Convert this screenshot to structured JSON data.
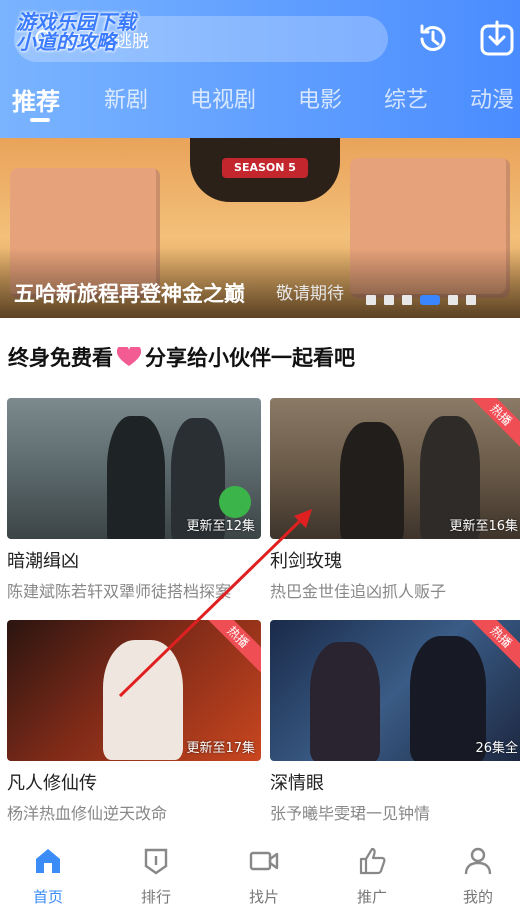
{
  "header": {
    "search_text": "密室大逃脱",
    "watermark": "游戏乐园下载\n小道的攻略"
  },
  "tabs": [
    "推荐",
    "新剧",
    "电视剧",
    "电影",
    "综艺",
    "动漫"
  ],
  "banner": {
    "title": "五哈新旅程再登神金之巅",
    "subtitle": "敬请期待",
    "logo_text": "SEASON 5",
    "dots": 6,
    "active_dot": 3
  },
  "section": {
    "title": "终身免费看",
    "title2": "分享给小伙伴一起看吧"
  },
  "cards": [
    {
      "title": "暗潮缉凶",
      "desc": "陈建斌陈若轩双犟师徒搭档探案",
      "episode": "更新至12集",
      "hot": ""
    },
    {
      "title": "利剑玫瑰",
      "desc": "热巴金世佳追凶抓人贩子",
      "episode": "更新至16集",
      "hot": "热播"
    },
    {
      "title": "凡人修仙传",
      "desc": "杨洋热血修仙逆天改命",
      "episode": "更新至17集",
      "hot": "热播"
    },
    {
      "title": "深情眼",
      "desc": "张予曦毕雯珺一见钟情",
      "episode": "26集全",
      "hot": "热播"
    }
  ],
  "nav": [
    "首页",
    "排行",
    "找片",
    "推广",
    "我的"
  ],
  "colors": {
    "accent": "#3b8cf7",
    "hot": "#ef4e55",
    "arrow": "#e02020"
  }
}
